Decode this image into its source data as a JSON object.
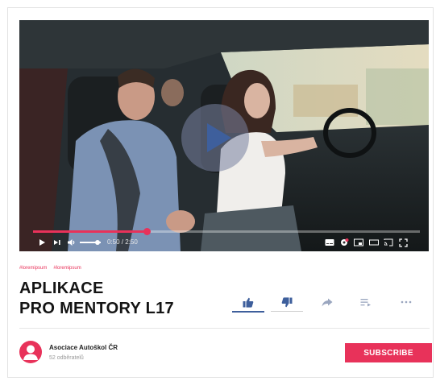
{
  "video": {
    "time_display": "0:50 / 2:50",
    "progress_fraction": 0.294,
    "volume_fraction": 0.85
  },
  "tags": [
    "#loremipsum",
    "#loremipsum"
  ],
  "title": {
    "line1": "APLIKACE",
    "line2": "PRO MENTORY L17"
  },
  "actions": [
    "thumbs-up-icon",
    "thumbs-down-icon",
    "share-icon",
    "add-to-queue-icon",
    "more-icon"
  ],
  "channel": {
    "name": "Asociace Autoškol ČR",
    "subscribers": "52 odběratelů"
  },
  "subscribe_label": "SUBSCRIBE",
  "colors": {
    "accent": "#e8325a",
    "action_active": "#3e5f9c"
  }
}
